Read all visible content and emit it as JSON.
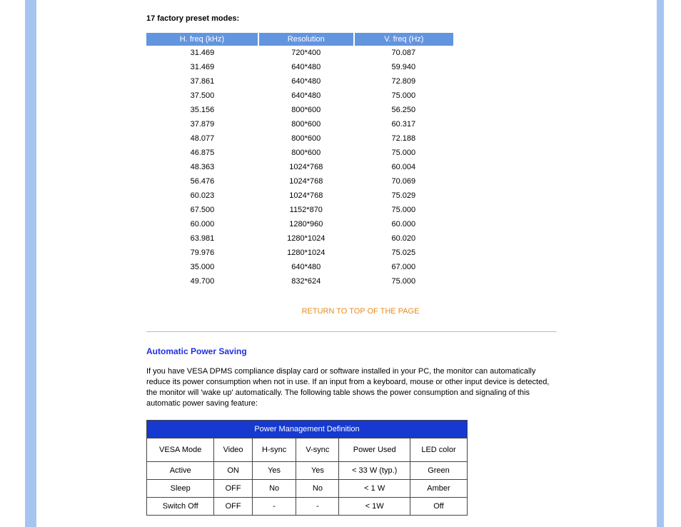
{
  "heading": "17 factory preset modes:",
  "preset_headers": [
    "H. freq (kHz)",
    "Resolution",
    "V. freq (Hz)"
  ],
  "preset_rows": [
    [
      "31.469",
      "720*400",
      "70.087"
    ],
    [
      "31.469",
      "640*480",
      "59.940"
    ],
    [
      "37.861",
      "640*480",
      "72.809"
    ],
    [
      "37.500",
      "640*480",
      "75.000"
    ],
    [
      "35.156",
      "800*600",
      "56.250"
    ],
    [
      "37.879",
      "800*600",
      "60.317"
    ],
    [
      "48.077",
      "800*600",
      "72.188"
    ],
    [
      "46.875",
      "800*600",
      "75.000"
    ],
    [
      "48.363",
      "1024*768",
      "60.004"
    ],
    [
      "56.476",
      "1024*768",
      "70.069"
    ],
    [
      "60.023",
      "1024*768",
      "75.029"
    ],
    [
      "67.500",
      "1152*870",
      "75.000"
    ],
    [
      "60.000",
      "1280*960",
      "60.000"
    ],
    [
      "63.981",
      "1280*1024",
      "60.020"
    ],
    [
      "79.976",
      "1280*1024",
      "75.025"
    ],
    [
      "35.000",
      "640*480",
      "67.000"
    ],
    [
      "49.700",
      "832*624",
      "75.000"
    ]
  ],
  "return_link": "RETURN TO TOP OF THE PAGE",
  "section_title": "Automatic Power Saving",
  "paragraph": "If you have VESA DPMS compliance display card or software installed in your PC, the monitor can automatically reduce its power consumption when not in use. If an input from a keyboard, mouse or other input device is detected, the monitor will 'wake up' automatically. The following table shows the power consumption and signaling of this automatic power saving feature:",
  "pm_title": "Power Management Definition",
  "pm_headers": [
    "VESA Mode",
    "Video",
    "H-sync",
    "V-sync",
    "Power Used",
    "LED color"
  ],
  "pm_rows": [
    [
      "Active",
      "ON",
      "Yes",
      "Yes",
      "< 33 W (typ.)",
      "Green"
    ],
    [
      "Sleep",
      "OFF",
      "No",
      "No",
      "< 1 W",
      "Amber"
    ],
    [
      "Switch Off",
      "OFF",
      "-",
      "-",
      "< 1W",
      "Off"
    ]
  ],
  "chart_data": {
    "type": "table",
    "tables": [
      {
        "title": "17 factory preset modes",
        "columns": [
          "H. freq (kHz)",
          "Resolution",
          "V. freq (Hz)"
        ],
        "data": [
          [
            31.469,
            "720*400",
            70.087
          ],
          [
            31.469,
            "640*480",
            59.94
          ],
          [
            37.861,
            "640*480",
            72.809
          ],
          [
            37.5,
            "640*480",
            75.0
          ],
          [
            35.156,
            "800*600",
            56.25
          ],
          [
            37.879,
            "800*600",
            60.317
          ],
          [
            48.077,
            "800*600",
            72.188
          ],
          [
            46.875,
            "800*600",
            75.0
          ],
          [
            48.363,
            "1024*768",
            60.004
          ],
          [
            56.476,
            "1024*768",
            70.069
          ],
          [
            60.023,
            "1024*768",
            75.029
          ],
          [
            67.5,
            "1152*870",
            75.0
          ],
          [
            60.0,
            "1280*960",
            60.0
          ],
          [
            63.981,
            "1280*1024",
            60.02
          ],
          [
            79.976,
            "1280*1024",
            75.025
          ],
          [
            35.0,
            "640*480",
            67.0
          ],
          [
            49.7,
            "832*624",
            75.0
          ]
        ]
      },
      {
        "title": "Power Management Definition",
        "columns": [
          "VESA Mode",
          "Video",
          "H-sync",
          "V-sync",
          "Power Used",
          "LED color"
        ],
        "data": [
          [
            "Active",
            "ON",
            "Yes",
            "Yes",
            "< 33 W (typ.)",
            "Green"
          ],
          [
            "Sleep",
            "OFF",
            "No",
            "No",
            "< 1 W",
            "Amber"
          ],
          [
            "Switch Off",
            "OFF",
            "-",
            "-",
            "< 1W",
            "Off"
          ]
        ]
      }
    ]
  }
}
